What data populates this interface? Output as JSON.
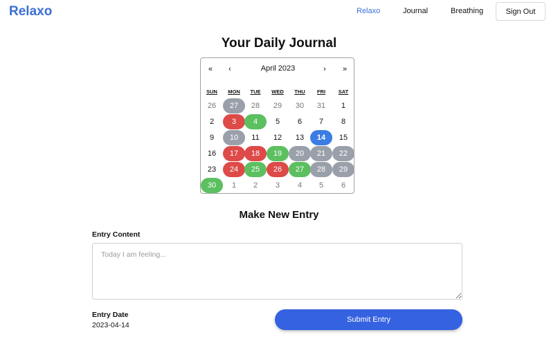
{
  "nav": {
    "brand": "Relaxo",
    "links": [
      "Relaxo",
      "Journal",
      "Breathing"
    ],
    "active_link": "Relaxo",
    "sign_out": "Sign Out"
  },
  "page_title": "Your Daily Journal",
  "calendar": {
    "month_label": "April 2023",
    "nav": {
      "prev_year": "«",
      "prev_month": "‹",
      "next_month": "›",
      "next_year": "»"
    },
    "weekdays": [
      "SUN",
      "MON",
      "TUE",
      "WED",
      "THU",
      "FRI",
      "SAT"
    ],
    "weeks": [
      [
        {
          "label": "26",
          "outside_month": true
        },
        {
          "label": "27",
          "outside_month": true,
          "mood": "gray"
        },
        {
          "label": "28",
          "outside_month": true
        },
        {
          "label": "29",
          "outside_month": true
        },
        {
          "label": "30",
          "outside_month": true
        },
        {
          "label": "31",
          "outside_month": true
        },
        {
          "label": "1"
        }
      ],
      [
        {
          "label": "2"
        },
        {
          "label": "3",
          "mood": "red"
        },
        {
          "label": "4",
          "mood": "green"
        },
        {
          "label": "5"
        },
        {
          "label": "6"
        },
        {
          "label": "7"
        },
        {
          "label": "8"
        }
      ],
      [
        {
          "label": "9"
        },
        {
          "label": "10",
          "mood": "gray"
        },
        {
          "label": "11"
        },
        {
          "label": "12"
        },
        {
          "label": "13"
        },
        {
          "label": "14",
          "today": true
        },
        {
          "label": "15"
        }
      ],
      [
        {
          "label": "16"
        },
        {
          "label": "17",
          "mood": "red"
        },
        {
          "label": "18",
          "mood": "red"
        },
        {
          "label": "19",
          "mood": "green"
        },
        {
          "label": "20",
          "mood": "gray"
        },
        {
          "label": "21",
          "mood": "gray"
        },
        {
          "label": "22",
          "mood": "gray"
        }
      ],
      [
        {
          "label": "23"
        },
        {
          "label": "24",
          "mood": "red"
        },
        {
          "label": "25",
          "mood": "green"
        },
        {
          "label": "26",
          "mood": "red"
        },
        {
          "label": "27",
          "mood": "green"
        },
        {
          "label": "28",
          "mood": "gray"
        },
        {
          "label": "29",
          "mood": "gray"
        }
      ],
      [
        {
          "label": "30",
          "mood": "green"
        },
        {
          "label": "1",
          "outside_month": true
        },
        {
          "label": "2",
          "outside_month": true
        },
        {
          "label": "3",
          "outside_month": true
        },
        {
          "label": "4",
          "outside_month": true
        },
        {
          "label": "5",
          "outside_month": true
        },
        {
          "label": "6",
          "outside_month": true
        }
      ]
    ],
    "colors": {
      "gray": "#9aa0aa",
      "red": "#dd4a48",
      "green": "#5cbf60",
      "today": "#3b7de5"
    }
  },
  "entry": {
    "heading": "Make New Entry",
    "content_label": "Entry Content",
    "content_placeholder": "Today I am feeling...",
    "content_value": "",
    "date_label": "Entry Date",
    "date_value": "2023-04-14",
    "submit_label": "Submit Entry"
  },
  "colors": {
    "brand": "#3b6fd6",
    "submit": "#3562e0"
  }
}
